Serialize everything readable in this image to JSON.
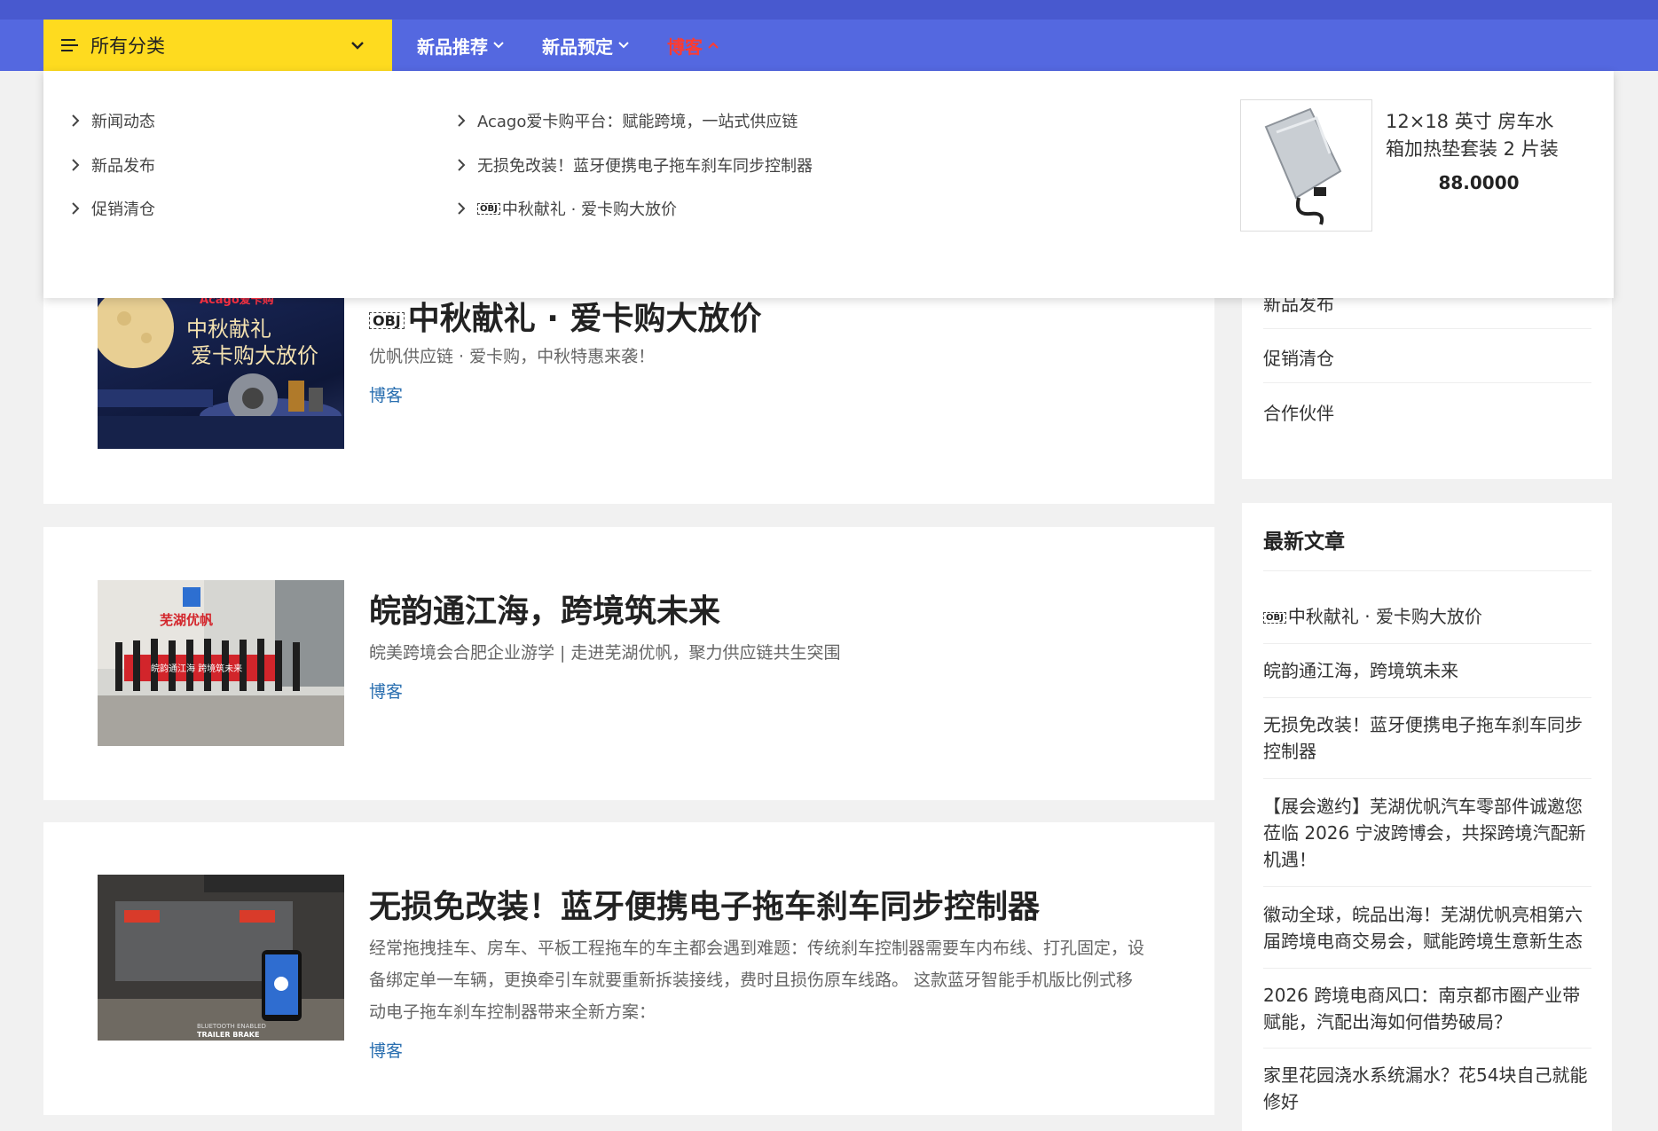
{
  "nav": {
    "all_categories": "所有分类",
    "items": [
      {
        "label": "新品推荐"
      },
      {
        "label": "新品预定"
      },
      {
        "label": "博客"
      }
    ]
  },
  "dropdown": {
    "col1": [
      "新闻动态",
      "新品发布",
      "促销清仓"
    ],
    "col2": [
      "Acago爱卡购平台：赋能跨境，一站式供应链",
      "无损免改装！蓝牙便携电子拖车刹车同步控制器",
      "中秋献礼 · 爱卡购大放价"
    ],
    "obj_mark": "OBJ",
    "product": {
      "name": "12×18 英寸 房车水箱加热垫套装 2 片装",
      "price": "88.0000"
    }
  },
  "posts": [
    {
      "title": "中秋献礼 · 爱卡购大放价",
      "excerpt": "优帆供应链 · 爱卡购，中秋特惠来袭！",
      "category": "博客",
      "thumb_text": {
        "brand": "Acago爱卡购",
        "line1": "中秋献礼",
        "line2": "爱卡购大放价"
      }
    },
    {
      "title": "皖韵通江海，跨境筑未来",
      "excerpt": "皖美跨境会合肥企业游学 | 走进芜湖优帆，聚力供应链共生突围",
      "category": "博客",
      "thumb_text": {
        "sign": "芜湖优帆",
        "banner": "皖韵通江海 跨境筑未来"
      }
    },
    {
      "title": "无损免改装！蓝牙便携电子拖车刹车同步控制器",
      "excerpt": "经常拖拽挂车、房车、平板工程拖车的车主都会遇到难题：传统刹车控制器需要车内布线、打孔固定，设备绑定单一车辆，更换牵引车就要重新拆装接线，费时且损伤原车线路。 这款蓝牙智能手机版比例式移动电子拖车刹车控制器带来全新方案：",
      "category": "博客",
      "thumb_text": {
        "caption1": "BLUETOOTH ENABLED",
        "caption2": "TRAILER BRAKE"
      }
    }
  ],
  "sidebar": {
    "categories_partial": [
      "新品发布",
      "促销清仓",
      "合作伙伴"
    ],
    "recent_title": "最新文章",
    "recent": [
      "中秋献礼 · 爱卡购大放价",
      "皖韵通江海，跨境筑未来",
      "无损免改装！蓝牙便携电子拖车刹车同步控制器",
      "【展会邀约】芜湖优帆汽车零部件诚邀您莅临 2026 宁波跨博会，共探跨境汽配新机遇！",
      "徽动全球，皖品出海！芜湖优帆亮相第六届跨境电商交易会，赋能跨境生意新生态",
      "2026 跨境电商风口：南京都市圈产业带赋能，汽配出海如何借势破局？",
      "家里花园浇水系统漏水？花54块自己就能修好"
    ]
  }
}
